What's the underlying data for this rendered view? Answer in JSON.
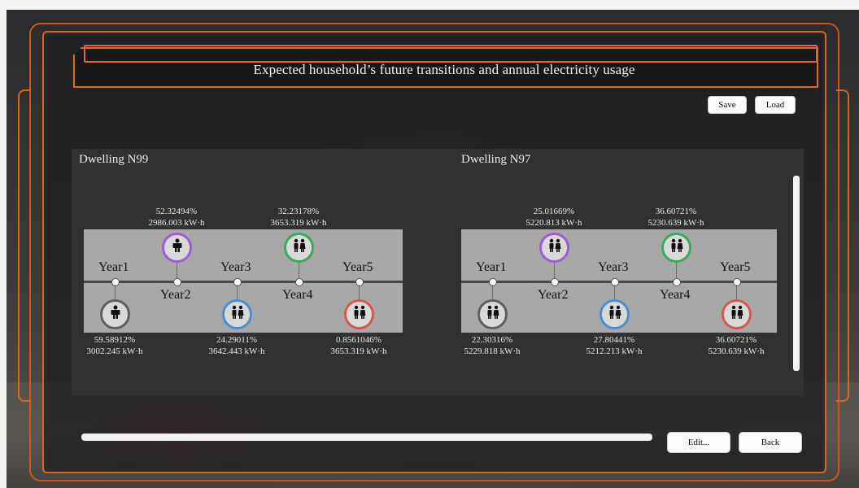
{
  "title": "Expected household’s future transitions and annual electricity usage",
  "toolbar": {
    "save_label": "Save",
    "load_label": "Load"
  },
  "footer": {
    "edit_label": "Edit...",
    "back_label": "Back"
  },
  "colors": {
    "frame_orange": "#d9661e",
    "ring_gray": "#5f5f5f",
    "ring_purple": "#a35bd2",
    "ring_blue": "#4b8fd3",
    "ring_green": "#3fa85c",
    "ring_red": "#d65a4a"
  },
  "dwellings": [
    {
      "title": "Dwelling N99",
      "years": [
        "Year1",
        "Year2",
        "Year3",
        "Year4",
        "Year5"
      ],
      "stats": [
        {
          "pct": "59.58912%",
          "kwh": "3002.245 kW·h",
          "icon": "single-man-icon",
          "ring": "gray"
        },
        {
          "pct": "52.32494%",
          "kwh": "2986.003 kW·h",
          "icon": "single-man-icon",
          "ring": "purple"
        },
        {
          "pct": "24.29011%",
          "kwh": "3642.443 kW·h",
          "icon": "couple-icon",
          "ring": "blue"
        },
        {
          "pct": "32.23178%",
          "kwh": "3653.319 kW·h",
          "icon": "couple-icon",
          "ring": "green"
        },
        {
          "pct": "0.8561046%",
          "kwh": "3653.319 kW·h",
          "icon": "couple-icon",
          "ring": "red"
        }
      ]
    },
    {
      "title": "Dwelling N97",
      "years": [
        "Year1",
        "Year2",
        "Year3",
        "Year4",
        "Year5"
      ],
      "stats": [
        {
          "pct": "22.30316%",
          "kwh": "5229.818 kW·h",
          "icon": "couple-icon",
          "ring": "gray"
        },
        {
          "pct": "25.01669%",
          "kwh": "5220.813 kW·h",
          "icon": "couple-icon",
          "ring": "purple"
        },
        {
          "pct": "27.80441%",
          "kwh": "5212.213 kW·h",
          "icon": "couple-icon",
          "ring": "blue"
        },
        {
          "pct": "36.60721%",
          "kwh": "5230.639 kW·h",
          "icon": "couple-icon",
          "ring": "green"
        },
        {
          "pct": "36.60721%",
          "kwh": "5230.639 kW·h",
          "icon": "couple-icon",
          "ring": "red"
        }
      ]
    }
  ]
}
